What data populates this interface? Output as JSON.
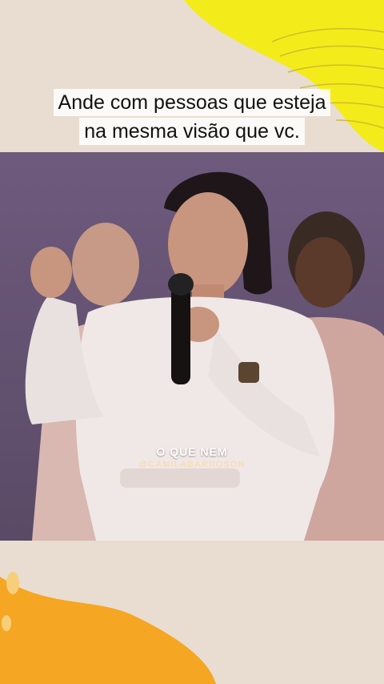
{
  "caption": {
    "line1": "Ande com pessoas que esteja",
    "line2": "na mesma visão que vc."
  },
  "video": {
    "overlay_text": "O QUE NEM",
    "overlay_subtext": "@CAMILABARROSON"
  },
  "colors": {
    "background": "#e8ddd0",
    "accent_yellow": "#f3ec1a",
    "accent_orange": "#f5a623",
    "video_bg": "#6b5a78"
  }
}
